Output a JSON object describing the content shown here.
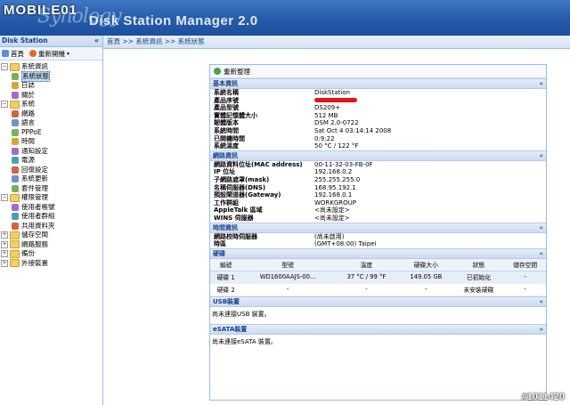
{
  "header": {
    "brand_watermark": "MOBILE01",
    "logo": "Synology",
    "title": "Disk Station Manager 2.0"
  },
  "left_panel": {
    "title": "Disk Station",
    "collapse_icon": "«",
    "toolbar": {
      "home": "首頁",
      "restart": "重新開機"
    },
    "tree": [
      {
        "label": "系統資訊",
        "level": 0,
        "expanded": true
      },
      {
        "label": "系統狀態",
        "level": 1,
        "selected": true
      },
      {
        "label": "日誌",
        "level": 1
      },
      {
        "label": "關於",
        "level": 1
      },
      {
        "label": "系統",
        "level": 0,
        "expanded": true
      },
      {
        "label": "網路",
        "level": 1
      },
      {
        "label": "語言",
        "level": 1
      },
      {
        "label": "PPPoE",
        "level": 1
      },
      {
        "label": "時間",
        "level": 1
      },
      {
        "label": "通知設定",
        "level": 1
      },
      {
        "label": "電源",
        "level": 1
      },
      {
        "label": "回復設定",
        "level": 1
      },
      {
        "label": "系統更新",
        "level": 1
      },
      {
        "label": "套件管理",
        "level": 1
      },
      {
        "label": "權限管理",
        "level": 0,
        "expanded": true
      },
      {
        "label": "使用者帳號",
        "level": 1
      },
      {
        "label": "使用者群組",
        "level": 1
      },
      {
        "label": "共用資料夾",
        "level": 1
      },
      {
        "label": "儲存空間",
        "level": 0
      },
      {
        "label": "網路服務",
        "level": 0
      },
      {
        "label": "備份",
        "level": 0
      },
      {
        "label": "外接裝置",
        "level": 0
      }
    ]
  },
  "breadcrumb": "首頁 >> 系統資訊 >> 系統狀態",
  "dialog": {
    "refresh": "重新整理",
    "basic": {
      "title": "基本資訊",
      "rows": [
        {
          "k": "系統名稱",
          "v": "DiskStation"
        },
        {
          "k": "產品序號",
          "v": ""
        },
        {
          "k": "產品型號",
          "v": "DS209+"
        },
        {
          "k": "實體記憶體大小",
          "v": "512 MB"
        },
        {
          "k": "韌體版本",
          "v": "DSM 2.0-0722"
        },
        {
          "k": "系統時間",
          "v": "Sat Oct 4 03:14:14 2008"
        },
        {
          "k": "已開機時間",
          "v": "0:9:22"
        },
        {
          "k": "系統溫度",
          "v": "50 °C / 122 °F"
        }
      ]
    },
    "network": {
      "title": "網路資訊",
      "rows": [
        {
          "k": "網路資料位址(MAC address)",
          "v": "00-11-32-03-FB-0F"
        },
        {
          "k": "IP 位址",
          "v": "192.168.0.2"
        },
        {
          "k": "子網路遮罩(mask)",
          "v": "255.255.255.0"
        },
        {
          "k": "名稱伺服器(DNS)",
          "v": "168.95.192.1"
        },
        {
          "k": "預設閘道器(Gateway)",
          "v": "192.168.0.1"
        },
        {
          "k": "工作群組",
          "v": "WORKGROUP"
        },
        {
          "k": "AppleTalk 區域",
          "v": "<尚未設定>"
        },
        {
          "k": "WINS 伺服器",
          "v": "<尚未設定>"
        }
      ]
    },
    "time": {
      "title": "時間資訊",
      "rows": [
        {
          "k": "網路校時伺服器",
          "v": "(尚未啟用)"
        },
        {
          "k": "時區",
          "v": "(GMT+08:00) Taipei"
        }
      ]
    },
    "disks": {
      "title": "硬碟",
      "headers": [
        "編號",
        "型號",
        "溫度",
        "硬碟大小",
        "狀態",
        "儲存空間"
      ],
      "rows": [
        [
          "硬碟 1",
          "WD1600AAJS-00...",
          "37 °C / 99 °F",
          "149.05 GB",
          "已初始化",
          "-"
        ],
        [
          "硬碟 2",
          "-",
          "-",
          "-",
          "未安裝硬碟",
          "-"
        ]
      ]
    },
    "usb": {
      "title": "USB裝置",
      "text": "尚未連接USB 裝置。"
    },
    "esata": {
      "title": "eSATA裝置",
      "text": "尚未連接eSATA 裝置。"
    }
  },
  "watermark": "#1011420"
}
